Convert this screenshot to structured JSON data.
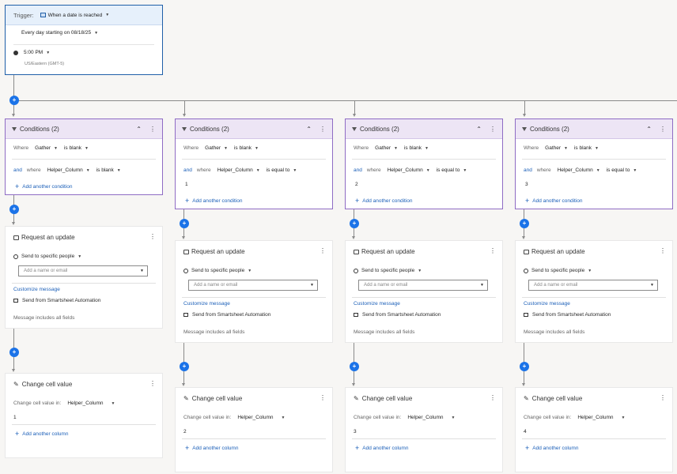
{
  "trigger": {
    "label": "Trigger:",
    "value": "When a date is reached",
    "frequency": "Every day starting on 08/18/25",
    "time": "5:00 PM",
    "timezone": "US/Eastern (GMT-5)"
  },
  "conditions": [
    {
      "title": "Conditions (2)",
      "where": "Where",
      "field1": "Gather",
      "op1": "is blank",
      "and": "and",
      "where2": "where",
      "field2": "Helper_Column",
      "op2": "is blank",
      "value2": "",
      "add": "Add another condition"
    },
    {
      "title": "Conditions (2)",
      "where": "Where",
      "field1": "Gather",
      "op1": "is blank",
      "and": "and",
      "where2": "where",
      "field2": "Helper_Column",
      "op2": "is equal to",
      "value2": "1",
      "add": "Add another condition"
    },
    {
      "title": "Conditions (2)",
      "where": "Where",
      "field1": "Gather",
      "op1": "is blank",
      "and": "and",
      "where2": "where",
      "field2": "Helper_Column",
      "op2": "is equal to",
      "value2": "2",
      "add": "Add another condition"
    },
    {
      "title": "Conditions (2)",
      "where": "Where",
      "field1": "Gather",
      "op1": "is blank",
      "and": "and",
      "where2": "where",
      "field2": "Helper_Column",
      "op2": "is equal to",
      "value2": "3",
      "add": "Add another condition"
    }
  ],
  "request": {
    "title": "Request an update",
    "send_to": "Send to specific people",
    "placeholder": "Add a name or email",
    "customize": "Customize message",
    "send_from": "Send from Smartsheet Automation",
    "includes": "Message includes all fields"
  },
  "change": [
    {
      "title": "Change cell value",
      "label": "Change cell value in:",
      "field": "Helper_Column",
      "value": "1",
      "add": "Add another column"
    },
    {
      "title": "Change cell value",
      "label": "Change cell value in:",
      "field": "Helper_Column",
      "value": "2",
      "add": "Add another column"
    },
    {
      "title": "Change cell value",
      "label": "Change cell value in:",
      "field": "Helper_Column",
      "value": "3",
      "add": "Add another column"
    },
    {
      "title": "Change cell value",
      "label": "Change cell value in:",
      "field": "Helper_Column",
      "value": "4",
      "add": "Add another column"
    }
  ],
  "icons": {
    "add": "plus-icon",
    "collapse": "chevron-up-icon",
    "menu": "kebab-menu-icon",
    "dropdown": "caret-down-icon"
  }
}
